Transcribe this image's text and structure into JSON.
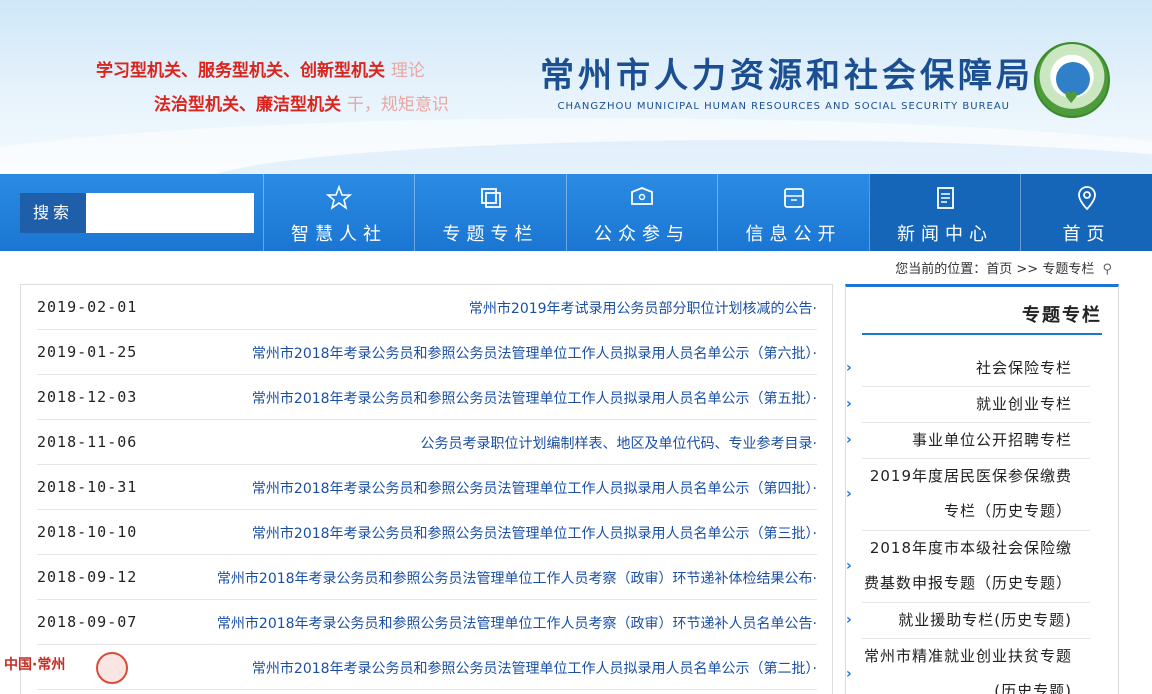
{
  "header": {
    "title_cn": "常州市人力资源和社会保障局",
    "title_en": "CHANGZHOU MUNICIPAL HUMAN RESOURCES AND SOCIAL SECURITY BUREAU",
    "slogan1_red": "学习型机关、服务型机关、创新型机关",
    "slogan1_faded": "理论",
    "slogan2_red": "法治型机关、廉洁型机关",
    "slogan2_faded": "干，规矩意识"
  },
  "search": {
    "button_label": "搜索",
    "placeholder": ""
  },
  "nav": {
    "items": [
      {
        "label": "首页",
        "icon": "location-pin-icon"
      },
      {
        "label": "新闻中心",
        "icon": "document-icon"
      },
      {
        "label": "信息公开",
        "icon": "inbox-icon"
      },
      {
        "label": "公众参与",
        "icon": "chat-icon"
      },
      {
        "label": "专题专栏",
        "icon": "copy-icon"
      },
      {
        "label": "智慧人社",
        "icon": "star-icon"
      }
    ]
  },
  "breadcrumb": {
    "text": "您当前的位置：首页 >> 专题专栏"
  },
  "list": {
    "rows": [
      {
        "title": "常州市2019年考试录用公务员部分职位计划核减的公告·",
        "date": "2019-02-01"
      },
      {
        "title": "常州市2018年考录公务员和参照公务员法管理单位工作人员拟录用人员名单公示（第六批）·",
        "date": "2019-01-25"
      },
      {
        "title": "常州市2018年考录公务员和参照公务员法管理单位工作人员拟录用人员名单公示（第五批）·",
        "date": "2018-12-03"
      },
      {
        "title": "公务员考录职位计划编制样表、地区及单位代码、专业参考目录·",
        "date": "2018-11-06"
      },
      {
        "title": "常州市2018年考录公务员和参照公务员法管理单位工作人员拟录用人员名单公示（第四批）·",
        "date": "2018-10-31"
      },
      {
        "title": "常州市2018年考录公务员和参照公务员法管理单位工作人员拟录用人员名单公示（第三批）·",
        "date": "2018-10-10"
      },
      {
        "title": "常州市2018年考录公务员和参照公务员法管理单位工作人员考察（政审）环节递补体检结果公布·",
        "date": "2018-09-12"
      },
      {
        "title": "常州市2018年考录公务员和参照公务员法管理单位工作人员考察（政审）环节递补人员名单公告·",
        "date": "2018-09-07"
      },
      {
        "title": "常州市2018年考录公务员和参照公务员法管理单位工作人员拟录用人员名单公示（第二批）·",
        "date": ""
      }
    ]
  },
  "sidebar": {
    "title": "专题专栏",
    "items": [
      {
        "label": "社会保险专栏"
      },
      {
        "label": "就业创业专栏"
      },
      {
        "label": "事业单位公开招聘专栏"
      },
      {
        "label": "2019年度居民医保参保缴费专栏（历史专题）"
      },
      {
        "label": "2018年度市本级社会保险缴费基数申报专题（历史专题）"
      },
      {
        "label": "就业援助专栏(历史专题)"
      },
      {
        "label": "常州市精准就业创业扶贫专题(历史专题)"
      }
    ]
  },
  "footer": {
    "emblem_text": "中国·常州"
  },
  "colors": {
    "nav_blue": "#1a76d2",
    "nav_active": "#1565b8",
    "link_blue": "#1a4fa5",
    "slogan_red": "#d9251d",
    "title_blue": "#1c4f91"
  }
}
